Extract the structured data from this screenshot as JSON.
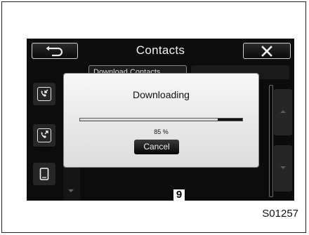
{
  "header": {
    "title": "Contacts"
  },
  "tabs": {
    "left_label": "Download Contacts"
  },
  "dialog": {
    "title": "Downloading",
    "progress": 0.85,
    "progress_label": "85 %",
    "cancel_label": "Cancel"
  },
  "callout_number": "9",
  "figure_id": "S01257",
  "icons": {
    "back": "back-arrow-icon",
    "close": "close-x-icon",
    "incoming_call": "incoming-call-icon",
    "outgoing_call": "outgoing-call-icon",
    "phone_device": "phone-device-icon"
  },
  "colors": {
    "screen_bg": "#0c0c0c",
    "dialog_bg": "#eeeeee",
    "button_border": "#cfcfcf"
  }
}
